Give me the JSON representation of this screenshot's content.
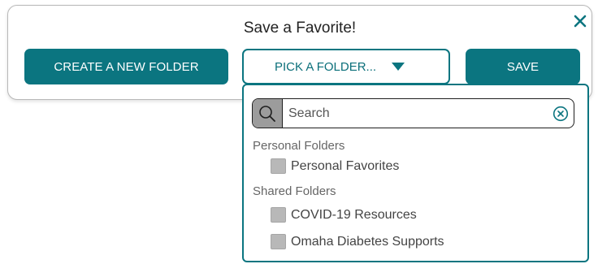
{
  "dialog": {
    "title": "Save a Favorite!",
    "close_icon": "close-icon",
    "create_button_label": "CREATE A NEW FOLDER",
    "picker_label": "PICK A FOLDER...",
    "save_button_label": "SAVE"
  },
  "dropdown": {
    "search": {
      "placeholder": "Search",
      "value": "",
      "icon": "search-icon",
      "clear_icon": "clear-circle-icon"
    },
    "groups": [
      {
        "heading": "Personal Folders",
        "items": [
          {
            "label": "Personal Favorites",
            "checked": false
          }
        ]
      },
      {
        "heading": "Shared Folders",
        "items": [
          {
            "label": "COVID-19 Resources",
            "checked": false
          },
          {
            "label": "Omaha Diabetes Supports",
            "checked": false
          }
        ]
      }
    ]
  },
  "colors": {
    "brand_teal": "#0b7580",
    "checkbox_gray": "#b8b8b8",
    "search_icon_bg": "#9c9c9c"
  }
}
